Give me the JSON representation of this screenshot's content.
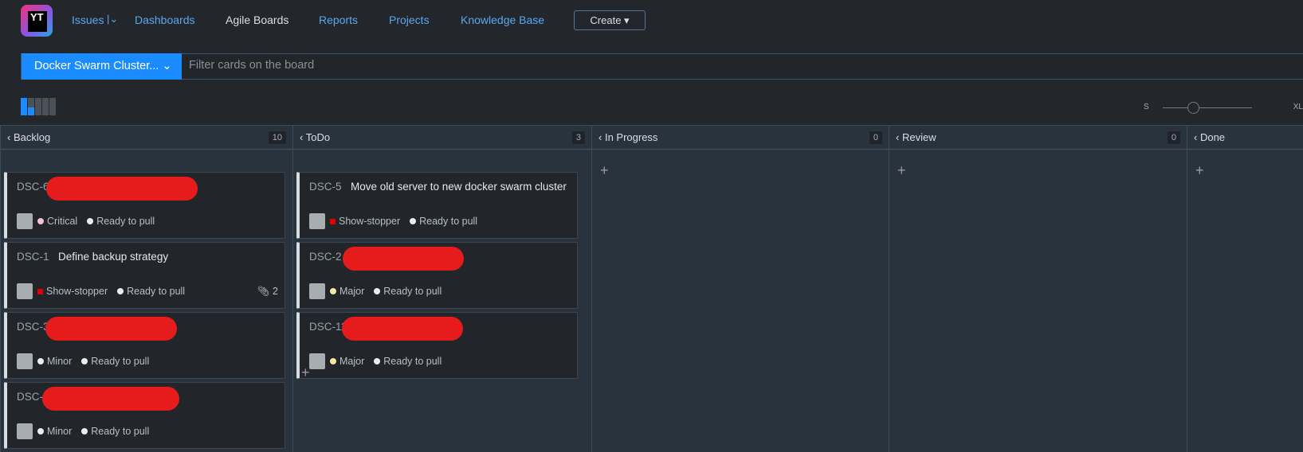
{
  "nav": {
    "logo": "YT",
    "items": [
      "Issues",
      "Dashboards",
      "Agile Boards",
      "Reports",
      "Projects",
      "Knowledge Base"
    ],
    "create": "Create ▾"
  },
  "toolbar": {
    "project": "Docker Swarm Cluster... ⌄",
    "filter_placeholder": "Filter cards on the board",
    "size_min": "S",
    "size_max": "XL",
    "card_size_level": 0.2
  },
  "columns": [
    {
      "name": "Backlog",
      "count": "10"
    },
    {
      "name": "ToDo",
      "count": "3"
    },
    {
      "name": "In Progress",
      "count": "0"
    },
    {
      "name": "Review",
      "count": "0"
    },
    {
      "name": "Done",
      "count": ""
    }
  ],
  "cards": {
    "backlog": [
      {
        "id": "DSC-6",
        "title": "",
        "priority": "Critical",
        "priority_color": "#f7c2d6",
        "state": "Ready to pull"
      },
      {
        "id": "DSC-1",
        "title": "Define backup strategy",
        "priority": "Show-stopper",
        "priority_color": "#e30000",
        "state": "Ready to pull",
        "attachments": "2"
      },
      {
        "id": "DSC-3",
        "title": "",
        "priority": "Minor",
        "priority_color": "#eeeeee",
        "state": "Ready to pull"
      },
      {
        "id": "DSC-4",
        "title": "",
        "priority": "Minor",
        "priority_color": "#eeeeee",
        "state": "Ready to pull"
      }
    ],
    "todo": [
      {
        "id": "DSC-5",
        "title": "Move old server to new docker swarm cluster",
        "priority": "Show-stopper",
        "priority_color": "#e30000",
        "state": "Ready to pull"
      },
      {
        "id": "DSC-2",
        "title": "",
        "priority": "Major",
        "priority_color": "#f8e9a0",
        "state": "Ready to pull"
      },
      {
        "id": "DSC-11",
        "title": "",
        "priority": "Major",
        "priority_color": "#f8e9a0",
        "state": "Ready to pull"
      }
    ]
  },
  "add_label": "+"
}
